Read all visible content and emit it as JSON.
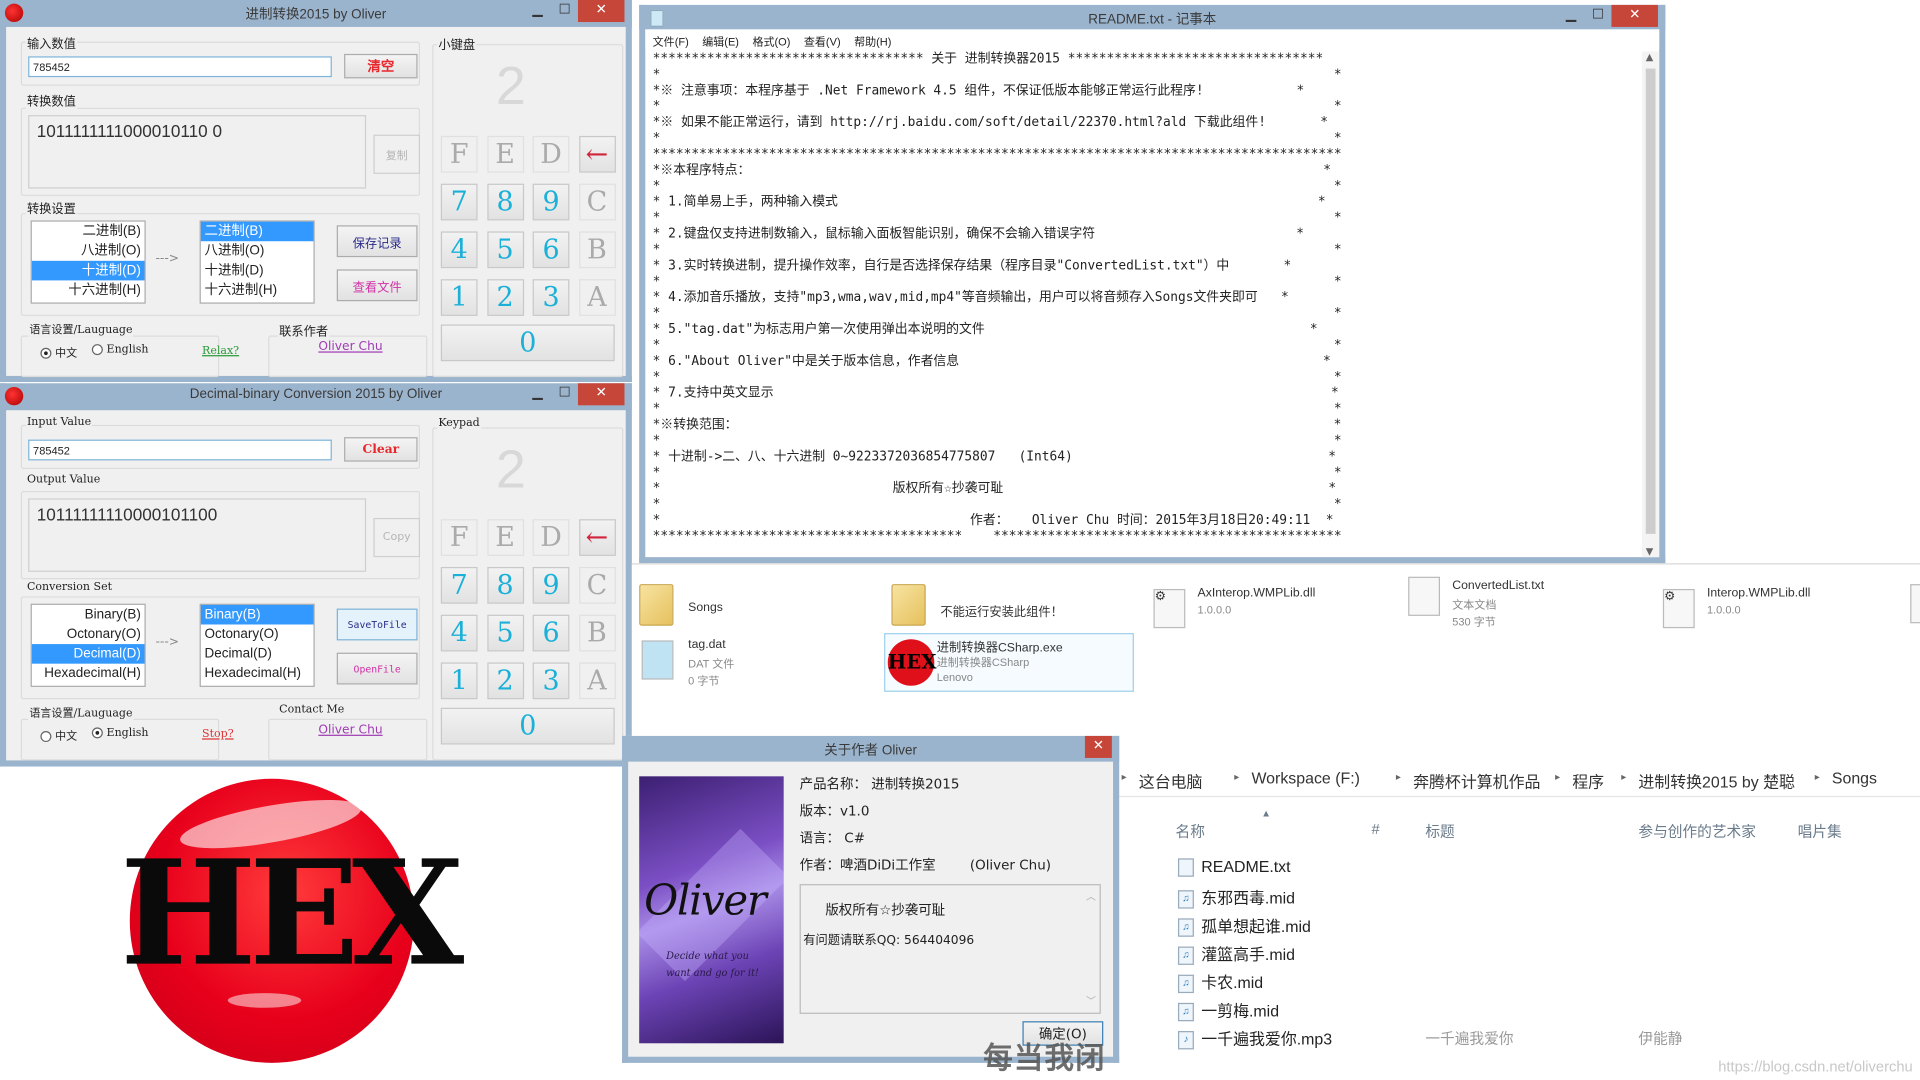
{
  "cn_window": {
    "title": "进制转换2015 by Oliver",
    "input_group_label": "输入数值",
    "input_value": "785452",
    "clear_label": "清空",
    "output_group_label": "转换数值",
    "output_value": "1011111111000010110 0",
    "copy_label": "复制",
    "settings_group_label": "转换设置",
    "from_list": [
      "二进制(B)",
      "八进制(O)",
      "十进制(D)",
      "十六进制(H)"
    ],
    "from_selected": 2,
    "arrow": "--->",
    "to_list": [
      "二进制(B)",
      "八进制(O)",
      "十进制(D)",
      "十六进制(H)"
    ],
    "to_selected": 0,
    "save_label": "保存记录",
    "view_label": "查看文件",
    "language_group_label": "语言设置/Lauguage",
    "lang_cn": "中文",
    "lang_en": "English",
    "lang_selected": "cn",
    "music_link": "Relax?",
    "contact_group_label": "联系作者",
    "contact_link": "Oliver Chu",
    "keypad_label": "小键盘"
  },
  "en_window": {
    "title": "Decimal-binary Conversion 2015 by Oliver",
    "input_group_label": "Input Value",
    "input_value": "785452",
    "clear_label": "Clear",
    "output_group_label": "Output Value",
    "output_value": "10111111110000101100",
    "copy_label": "Copy",
    "settings_group_label": "Conversion Set",
    "from_list": [
      "Binary(B)",
      "Octonary(O)",
      "Decimal(D)",
      "Hexadecimal(H)"
    ],
    "from_selected": 2,
    "arrow": "--->",
    "to_list": [
      "Binary(B)",
      "Octonary(O)",
      "Decimal(D)",
      "Hexadecimal(H)"
    ],
    "to_selected": 0,
    "save_label": "SaveToFile",
    "view_label": "OpenFile",
    "language_group_label": "语言设置/Lauguage",
    "lang_cn": "中文",
    "lang_en": "English",
    "lang_selected": "en",
    "music_link": "Stop?",
    "contact_group_label": "Contact Me",
    "contact_link": "Oliver Chu",
    "keypad_label": "Keypad"
  },
  "keypad": {
    "base_display": "2",
    "rows": [
      [
        {
          "k": "F",
          "enabled": false
        },
        {
          "k": "E",
          "enabled": false
        },
        {
          "k": "D",
          "enabled": false
        },
        {
          "k": "←",
          "enabled": true,
          "back": true
        }
      ],
      [
        {
          "k": "7",
          "enabled": true
        },
        {
          "k": "8",
          "enabled": true
        },
        {
          "k": "9",
          "enabled": true
        },
        {
          "k": "C",
          "enabled": false
        }
      ],
      [
        {
          "k": "4",
          "enabled": true
        },
        {
          "k": "5",
          "enabled": true
        },
        {
          "k": "6",
          "enabled": true
        },
        {
          "k": "B",
          "enabled": false
        }
      ],
      [
        {
          "k": "1",
          "enabled": true
        },
        {
          "k": "2",
          "enabled": true
        },
        {
          "k": "3",
          "enabled": true
        },
        {
          "k": "A",
          "enabled": false
        }
      ]
    ],
    "zero": "0"
  },
  "notepad": {
    "title": "README.txt - 记事本",
    "menu": [
      "文件(F)",
      "编辑(E)",
      "格式(O)",
      "查看(V)",
      "帮助(H)"
    ],
    "lines": [
      "*********************************** 关于 进制转换器2015 *********************************",
      "*                                                                                       *",
      "*※ 注意事项：本程序基于 .Net Framework 4.5 组件，不保证低版本能够正常运行此程序!            *",
      "*                                                                                       *",
      "*※ 如果不能正常运行，请到 http://rj.baidu.com/soft/detail/22370.html?ald 下载此组件!       *",
      "*                                                                                       *",
      "*****************************************************************************************",
      "*※本程序特点：                                                                          *",
      "*                                                                                       *",
      "* 1.简单易上手，两种输入模式                                                              *",
      "*                                                                                       *",
      "* 2.键盘仅支持进制数输入，鼠标输入面板智能识别，确保不会输入错误字符                          *",
      "*                                                                                       *",
      "* 3.实时转换进制，提升操作效率，自行是否选择保存结果（程序目录\"ConvertedList.txt\"）中       *",
      "*                                                                                       *",
      "* 4.添加音乐播放，支持\"mp3,wma,wav,mid,mp4\"等音频输出，用户可以将音频存入Songs文件夹即可   *",
      "*                                                                                       *",
      "* 5.\"tag.dat\"为标志用户第一次使用弹出本说明的文件                                          *",
      "*                                                                                       *",
      "* 6.\"About Oliver\"中是关于版本信息，作者信息                                               *",
      "*                                                                                       *",
      "* 7.支持中英文显示                                                                        *",
      "*                                                                                       *",
      "*※转换范围：                                                                             *",
      "*                                                                                       *",
      "* 十进制->二、八、十六进制 0~9223372036854775807   (Int64)                                 *",
      "*                                                                                       *",
      "*                              版权所有☆抄袭可耻                                          *",
      "*                                                                                       *",
      "*                                        作者：   Oliver Chu 时间：2015年3月18日20:49:11  *",
      "****************************************    *********************************************"
    ]
  },
  "explorer": {
    "items": [
      {
        "name": "Songs",
        "type": "folder",
        "sub": []
      },
      {
        "name": "不能运行安装此组件！",
        "type": "folder",
        "sub": []
      },
      {
        "name": "AxInterop.WMPLib.dll",
        "type": "dll",
        "sub": [
          "1.0.0.0"
        ]
      },
      {
        "name": "ConvertedList.txt",
        "type": "txt",
        "sub": [
          "文本文档",
          "530 字节"
        ]
      },
      {
        "name": "Interop.WMPLib.dll",
        "type": "dll",
        "sub": [
          "1.0.0.0"
        ]
      },
      {
        "name": "tag.dat",
        "type": "dat",
        "sub": [
          "DAT 文件",
          "0 字节"
        ]
      },
      {
        "name": "进制转换器CSharp.exe",
        "type": "exe",
        "sub": [
          "进制转换器CSharp",
          "Lenovo"
        ]
      }
    ],
    "breadcrumb": [
      "这台电脑",
      "Workspace (F:)",
      "奔腾杯计算机作品",
      "程序",
      "进制转换2015 by 楚聪",
      "Songs"
    ],
    "columns": [
      "名称",
      "#",
      "标题",
      "参与创作的艺术家",
      "唱片集"
    ],
    "files": [
      {
        "name": "README.txt",
        "icon": "txt",
        "title": "",
        "artist": ""
      },
      {
        "name": "东邪西毒.mid",
        "icon": "mid",
        "title": "",
        "artist": ""
      },
      {
        "name": "孤单想起谁.mid",
        "icon": "mid",
        "title": "",
        "artist": ""
      },
      {
        "name": "灌篮高手.mid",
        "icon": "mid",
        "title": "",
        "artist": ""
      },
      {
        "name": "卡农.mid",
        "icon": "mid",
        "title": "",
        "artist": ""
      },
      {
        "name": "一剪梅.mid",
        "icon": "mid",
        "title": "",
        "artist": ""
      },
      {
        "name": "一千遍我爱你.mp3",
        "icon": "mp3",
        "title": "一千遍我爱你",
        "artist": "伊能静"
      }
    ]
  },
  "about": {
    "title": "关于作者 Oliver",
    "product": "产品名称：  进制转换2015",
    "version": "版本：v1.0",
    "language": "语言：  C#",
    "author": "作者：啤酒DiDi工作室        (Oliver Chu)",
    "box_line1": "版权所有☆抄袭可耻",
    "box_line2": "有问题请联系QQ:  564404096",
    "ok_label": "确定(O)",
    "image_text": "Oliver",
    "image_caption": "Decide what you want and go for it!",
    "overlay_text": "每当我闭"
  },
  "logo": {
    "text": "HEX"
  },
  "watermark": "https://blog.csdn.net/oliverchu"
}
